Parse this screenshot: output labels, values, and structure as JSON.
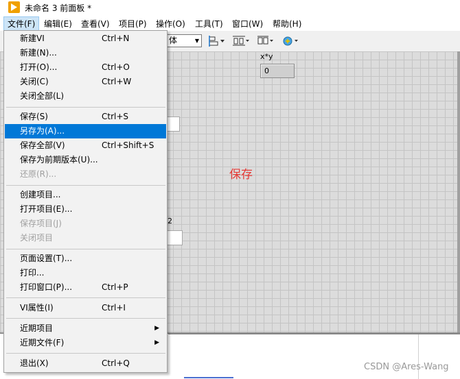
{
  "window": {
    "title": "未命名 3 前面板 *"
  },
  "menubar": {
    "items": [
      {
        "label": "文件(F)",
        "active": true
      },
      {
        "label": "编辑(E)"
      },
      {
        "label": "查看(V)"
      },
      {
        "label": "项目(P)"
      },
      {
        "label": "操作(O)"
      },
      {
        "label": "工具(T)"
      },
      {
        "label": "窗口(W)"
      },
      {
        "label": "帮助(H)"
      }
    ]
  },
  "toolbar": {
    "font_select_value": "体"
  },
  "front_panel": {
    "indicator_label": "x*y",
    "indicator_value": "0",
    "control_y_label_fragment": "2",
    "annotation": "保存",
    "annotation_color": "#e53935"
  },
  "file_menu": {
    "items": [
      {
        "label": "新建VI",
        "shortcut": "Ctrl+N"
      },
      {
        "label": "新建(N)...",
        "shortcut": ""
      },
      {
        "label": "打开(O)...",
        "shortcut": "Ctrl+O"
      },
      {
        "label": "关闭(C)",
        "shortcut": "Ctrl+W"
      },
      {
        "label": "关闭全部(L)",
        "shortcut": ""
      },
      {
        "label": "保存(S)",
        "shortcut": "Ctrl+S"
      },
      {
        "label": "另存为(A)...",
        "shortcut": "",
        "highlighted": true
      },
      {
        "label": "保存全部(V)",
        "shortcut": "Ctrl+Shift+S"
      },
      {
        "label": "保存为前期版本(U)...",
        "shortcut": ""
      },
      {
        "label": "还原(R)...",
        "shortcut": "",
        "disabled": true
      },
      {
        "label": "创建项目...",
        "shortcut": ""
      },
      {
        "label": "打开项目(E)...",
        "shortcut": ""
      },
      {
        "label": "保存项目(J)",
        "shortcut": "",
        "disabled": true
      },
      {
        "label": "关闭项目",
        "shortcut": "",
        "disabled": true
      },
      {
        "label": "页面设置(T)...",
        "shortcut": ""
      },
      {
        "label": "打印...",
        "shortcut": ""
      },
      {
        "label": "打印窗口(P)...",
        "shortcut": "Ctrl+P"
      },
      {
        "label": "VI属性(I)",
        "shortcut": "Ctrl+I"
      },
      {
        "label": "近期项目",
        "shortcut": "",
        "submenu": true
      },
      {
        "label": "近期文件(F)",
        "shortcut": "",
        "submenu": true
      },
      {
        "label": "退出(X)",
        "shortcut": "Ctrl+Q"
      }
    ]
  },
  "watermark": "CSDN @Ares-Wang",
  "colors": {
    "highlight": "#0078d7",
    "app_icon": "#f0a000",
    "canvas_bg": "#dcdcdc"
  }
}
